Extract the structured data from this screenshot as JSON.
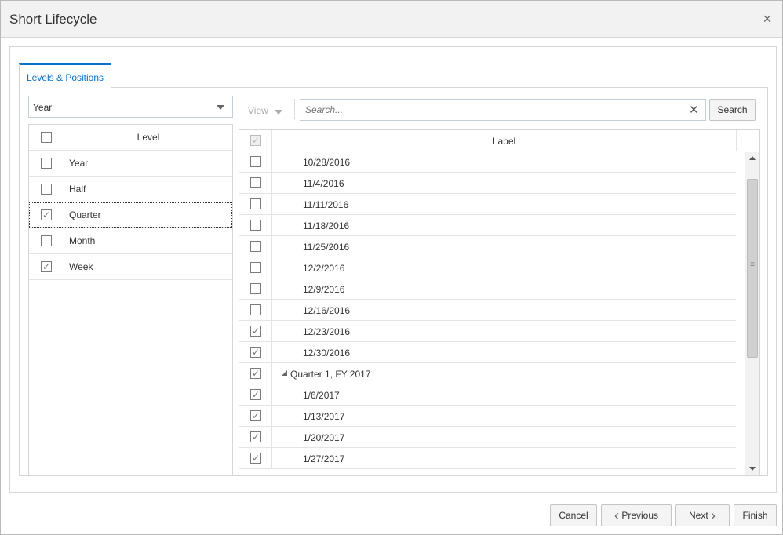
{
  "dialog": {
    "title": "Short Lifecycle",
    "close_glyph": "×"
  },
  "tabs": [
    {
      "label": "Levels & Positions",
      "active": true
    }
  ],
  "levels": {
    "selector_value": "Year",
    "header": "Level",
    "rows": [
      {
        "label": "Year",
        "checked": false
      },
      {
        "label": "Half",
        "checked": false
      },
      {
        "label": "Quarter",
        "checked": true,
        "selected": true
      },
      {
        "label": "Month",
        "checked": false
      },
      {
        "label": "Week",
        "checked": true
      }
    ]
  },
  "positions": {
    "view_label": "View",
    "search_placeholder": "Search...",
    "clear_glyph": "✕",
    "search_button": "Search",
    "header": "Label",
    "rows": [
      {
        "label": "10/28/2016",
        "checked": false
      },
      {
        "label": "11/4/2016",
        "checked": false
      },
      {
        "label": "11/11/2016",
        "checked": false
      },
      {
        "label": "11/18/2016",
        "checked": false
      },
      {
        "label": "11/25/2016",
        "checked": false
      },
      {
        "label": "12/2/2016",
        "checked": false
      },
      {
        "label": "12/9/2016",
        "checked": false
      },
      {
        "label": "12/16/2016",
        "checked": false
      },
      {
        "label": "12/23/2016",
        "checked": true
      },
      {
        "label": "12/30/2016",
        "checked": true
      },
      {
        "label": "Quarter 1, FY 2017",
        "checked": true,
        "group": true
      },
      {
        "label": "1/6/2017",
        "checked": true
      },
      {
        "label": "1/13/2017",
        "checked": true
      },
      {
        "label": "1/20/2017",
        "checked": true
      },
      {
        "label": "1/27/2017",
        "checked": true
      }
    ]
  },
  "footer": {
    "cancel": "Cancel",
    "previous": "Previous",
    "next": "Next",
    "finish": "Finish"
  },
  "colors": {
    "accent": "#0572ce",
    "titlebar": "#f2f2f2",
    "border": "#d6d6d6"
  }
}
